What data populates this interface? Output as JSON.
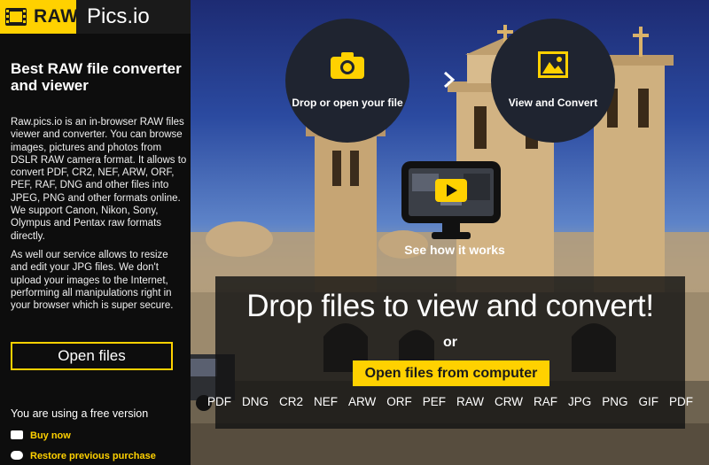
{
  "brand": {
    "badge": "RAW",
    "name": "Pics.io"
  },
  "sidebar": {
    "title": "Best RAW file converter and viewer",
    "description_1": "Raw.pics.io is an in-browser RAW files viewer and converter. You can browse images, pictures and photos from DSLR RAW camera format. It allows to convert PDF, CR2, NEF, ARW, ORF, PEF, RAF, DNG and other files into JPEG, PNG and other formats online. We support Canon, Nikon, Sony, Olympus and Pentax raw formats directly.",
    "description_2": "As well our service allows to resize and edit your JPG files. We don't upload your images to the Internet, performing all manipulations right in your browser which is super secure.",
    "open_files_label": "Open files",
    "version_text": "You are using a free version",
    "buy_label": "Buy now",
    "restore_label": "Restore previous purchase"
  },
  "main": {
    "step1_label": "Drop or open your file",
    "step2_label": "View and Convert",
    "how_it_works": "See how it works",
    "drop_title": "Drop files to view and convert!",
    "or_text": "or",
    "open_computer_label": "Open files from computer",
    "formats": [
      "PDF",
      "DNG",
      "CR2",
      "NEF",
      "ARW",
      "ORF",
      "PEF",
      "RAW",
      "CRW",
      "RAF",
      "JPG",
      "PNG",
      "GIF",
      "PDF"
    ]
  },
  "colors": {
    "accent": "#ffd100",
    "dark": "#1a1a1a",
    "circle": "#1f2430"
  },
  "icons": {
    "logo": "film-strip-icon",
    "step1": "camera-icon",
    "step2": "image-icon",
    "arrow": "chevron-right-icon",
    "video": "play-monitor-icon",
    "buy": "card-icon",
    "restore": "restore-icon"
  }
}
